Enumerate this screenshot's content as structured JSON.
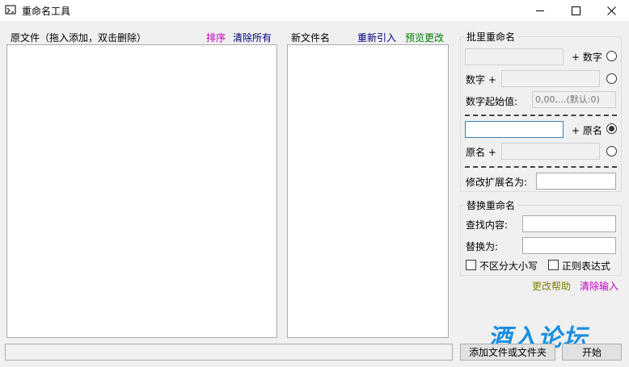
{
  "window": {
    "title": "重命名工具",
    "app_icon": "rename-tool-icon",
    "controls": [
      "minimize-icon",
      "maximize-icon",
      "close-icon"
    ]
  },
  "source_panel": {
    "label": "原文件（拖入添加，双击删除）",
    "sort_link": "排序",
    "clear_all_link": "清除所有"
  },
  "newname_panel": {
    "label": "新文件名",
    "reimport_link": "重新引入",
    "preview_link": "预览更改"
  },
  "batch_group": {
    "title": "批里重命名",
    "row1_value": "",
    "row1_suffix": "+ 数字",
    "row2_label": "数字 +",
    "row2_value": "",
    "start_label": "数字起始值:",
    "start_placeholder": "0,00,...(默认:0)",
    "row3_value": "",
    "row3_suffix": "+ 原名",
    "row4_label": "原名 +",
    "row4_value": "",
    "ext_label": "修改扩展名为:",
    "ext_value": "",
    "selected_option": 3
  },
  "replace_group": {
    "title": "替换重命名",
    "find_label": "查找内容:",
    "find_value": "",
    "replace_label": "替换为:",
    "replace_value": "",
    "case_label": "不区分大小写",
    "case_checked": false,
    "regex_label": "正则表达式",
    "regex_checked": false
  },
  "help_links": {
    "change_help": "更改帮助",
    "clear_input": "清除输入"
  },
  "bottom": {
    "add_button": "添加文件或文件夹",
    "start_button": "开始"
  },
  "watermark": "酒入论坛",
  "colors": {
    "sort": "#c000c0",
    "clear_all": "#000080",
    "reimport": "#000080",
    "preview": "#008000",
    "change_help": "#808000",
    "clear_input": "#c000c0",
    "watermark": "#1a8fe0"
  }
}
